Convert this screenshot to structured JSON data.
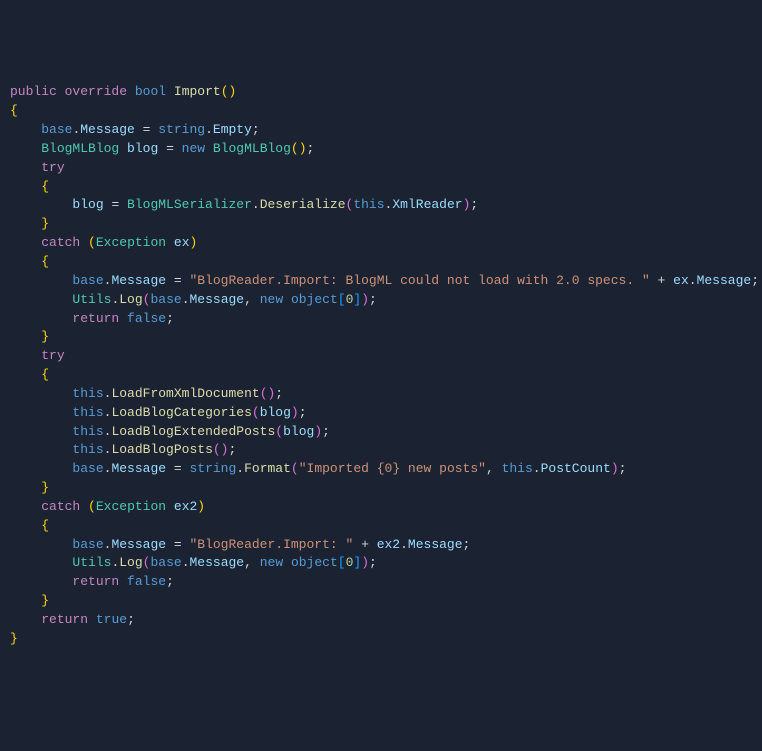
{
  "code": {
    "l1": {
      "kw1": "public",
      "kw2": "override",
      "kw3": "bool",
      "method": "Import"
    },
    "l2": {
      "brace": "{"
    },
    "l3": {
      "kw": "base",
      "prop": "Message",
      "eq": " = ",
      "kw2": "string",
      "prop2": "Empty"
    },
    "l4": {
      "type": "BlogMLBlog",
      "var": "blog",
      "eq": " = ",
      "kw": "new",
      "type2": "BlogMLBlog"
    },
    "l5": {
      "kw": "try"
    },
    "l6": {
      "brace": "{"
    },
    "l7": {
      "var": "blog",
      "eq": " = ",
      "type": "BlogMLSerializer",
      "method": "Deserialize",
      "kw": "this",
      "prop": "XmlReader"
    },
    "l8": {
      "brace": "}"
    },
    "l9": {
      "kw": "catch",
      "type": "Exception",
      "var": "ex"
    },
    "l10": {
      "brace": "{"
    },
    "l11": {
      "kw": "base",
      "prop": "Message",
      "str": "\"BlogReader.Import: BlogML could not load with 2.0 specs. \"",
      "var": "ex",
      "prop2": "Message"
    },
    "l12": {
      "type": "Utils",
      "method": "Log",
      "kw": "base",
      "prop": "Message",
      "kw2": "new",
      "kw3": "object",
      "num": "0"
    },
    "l13": {
      "kw": "return",
      "kw2": "false"
    },
    "l14": {
      "brace": "}"
    },
    "l15": {
      "kw": "try"
    },
    "l16": {
      "brace": "{"
    },
    "l17": {
      "kw": "this",
      "method": "LoadFromXmlDocument"
    },
    "l18": {
      "kw": "this",
      "method": "LoadBlogCategories",
      "var": "blog"
    },
    "l19": {
      "kw": "this",
      "method": "LoadBlogExtendedPosts",
      "var": "blog"
    },
    "l20": {
      "kw": "this",
      "method": "LoadBlogPosts"
    },
    "l21": {
      "kw": "base",
      "prop": "Message",
      "kw2": "string",
      "method": "Format",
      "str": "\"Imported {0} new posts\"",
      "kw3": "this",
      "prop2": "PostCount"
    },
    "l22": {
      "brace": "}"
    },
    "l23": {
      "kw": "catch",
      "type": "Exception",
      "var": "ex2"
    },
    "l24": {
      "brace": "{"
    },
    "l25": {
      "kw": "base",
      "prop": "Message",
      "str": "\"BlogReader.Import: \"",
      "var": "ex2",
      "prop2": "Message"
    },
    "l26": {
      "type": "Utils",
      "method": "Log",
      "kw": "base",
      "prop": "Message",
      "kw2": "new",
      "kw3": "object",
      "num": "0"
    },
    "l27": {
      "kw": "return",
      "kw2": "false"
    },
    "l28": {
      "brace": "}"
    },
    "l29": {
      "kw": "return",
      "kw2": "true"
    },
    "l30": {
      "brace": "}"
    }
  }
}
